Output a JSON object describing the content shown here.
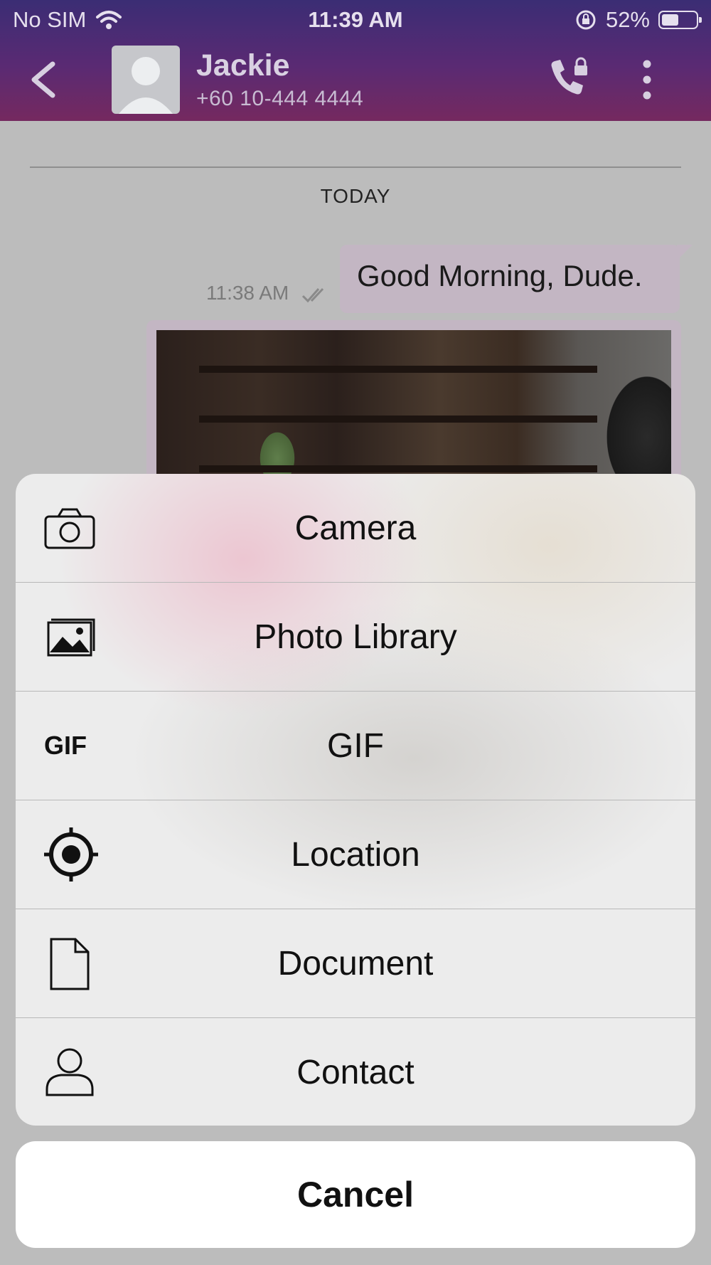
{
  "status_bar": {
    "carrier": "No SIM",
    "time": "11:39 AM",
    "battery": "52%",
    "battery_level": 0.52
  },
  "header": {
    "contact_name": "Jackie",
    "contact_phone": "+60 10-444 4444"
  },
  "chat": {
    "date_separator": "TODAY",
    "message_text": "Good Morning, Dude.",
    "message_time": "11:38 AM"
  },
  "action_sheet": {
    "items": [
      {
        "label": "Camera",
        "icon": "camera-icon"
      },
      {
        "label": "Photo Library",
        "icon": "photo-library-icon"
      },
      {
        "label": "GIF",
        "icon": "gif-icon"
      },
      {
        "label": "Location",
        "icon": "location-icon"
      },
      {
        "label": "Document",
        "icon": "document-icon"
      },
      {
        "label": "Contact",
        "icon": "contact-icon"
      }
    ],
    "cancel_label": "Cancel"
  },
  "colors": {
    "header_top": "#3b2d74",
    "header_bottom": "#75295f",
    "bubble": "#c3b6c3"
  }
}
